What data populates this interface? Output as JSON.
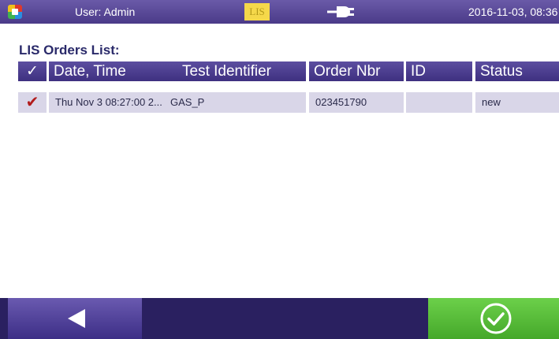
{
  "statusbar": {
    "user": "User: Admin",
    "lis_badge": "LIS",
    "datetime": "2016-11-03, 08:36",
    "connection_icon": "plug-icon"
  },
  "page": {
    "title": "LIS Orders List:"
  },
  "table": {
    "headers": [
      "✓",
      "Date, Time",
      "Test Identifier",
      "Order Nbr",
      "ID",
      "Status"
    ],
    "rows": [
      {
        "check": "✔",
        "date_time": "Thu Nov 3 08:27:00 2...",
        "test_identifier": "GAS_P",
        "order_nbr": "023451790",
        "id": "",
        "status": "new"
      }
    ]
  },
  "footer": {
    "back_icon": "back-arrow-icon",
    "ok_icon": "checkmark-circle-icon"
  },
  "colors": {
    "header_purple": "#4a3a88",
    "row_bg": "#d9d6e8",
    "ok_green": "#55b834",
    "check_red": "#b21c1c",
    "lis_yellow": "#f5d84a"
  }
}
